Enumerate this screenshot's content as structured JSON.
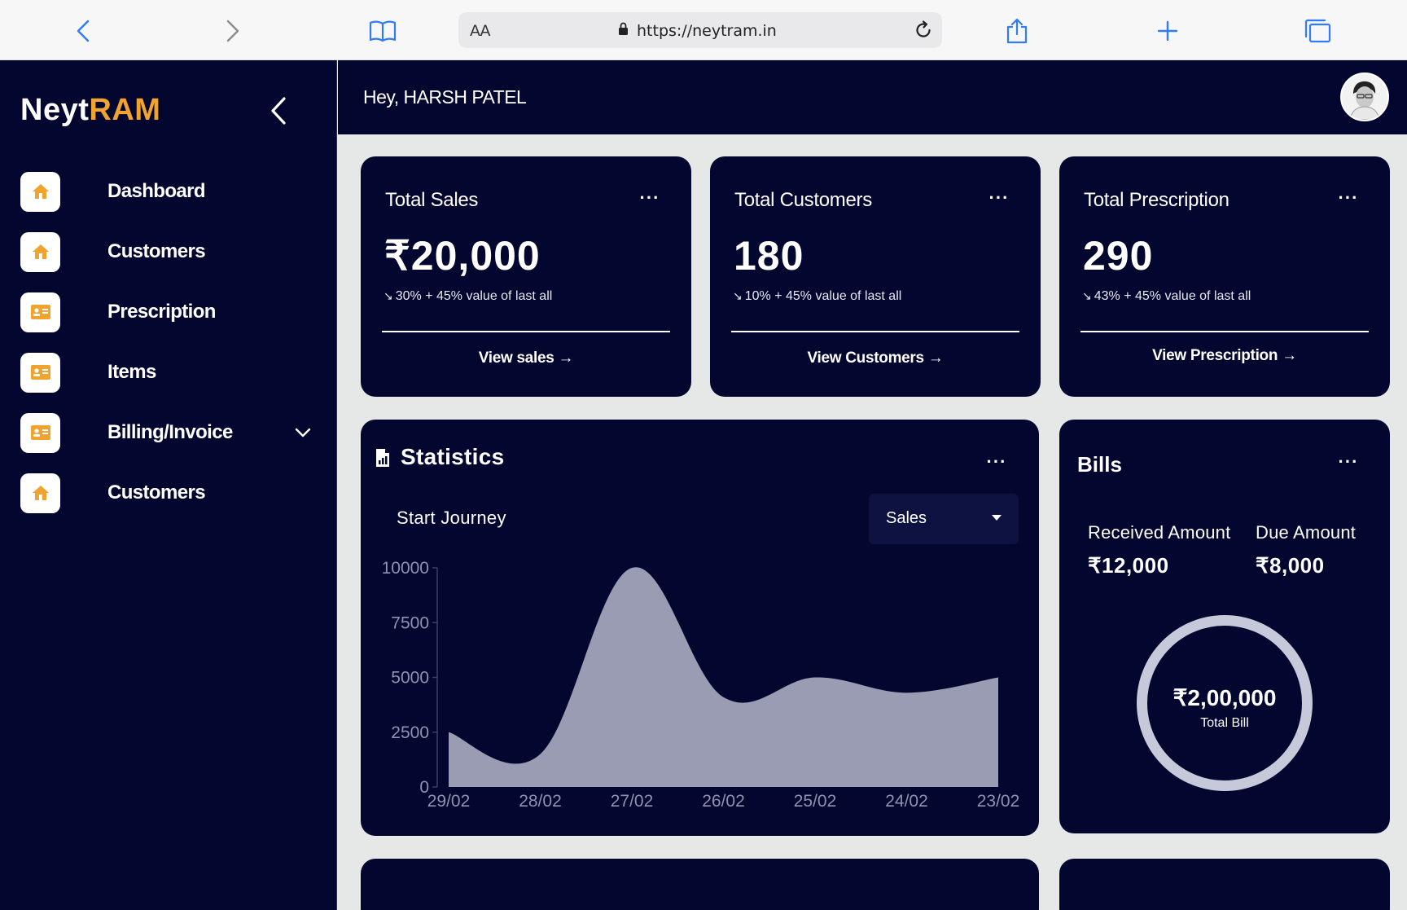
{
  "browser": {
    "text_size_label": "AA",
    "url": "https://neytram.in",
    "icons": [
      "back-icon",
      "forward-icon",
      "bookmarks-icon",
      "lock-icon",
      "reload-icon",
      "share-icon",
      "new-tab-icon",
      "tabs-icon"
    ]
  },
  "brand": {
    "part1": "Neyt",
    "part2": "RAM",
    "accent_color": "#f0a32e"
  },
  "sidebar": {
    "items": [
      {
        "label": "Dashboard",
        "icon": "home-icon"
      },
      {
        "label": "Customers",
        "icon": "home-icon"
      },
      {
        "label": "Prescription",
        "icon": "id-card-icon"
      },
      {
        "label": "Items",
        "icon": "id-card-icon"
      },
      {
        "label": "Billing/Invoice",
        "icon": "id-card-icon",
        "has_dropdown": true
      },
      {
        "label": "Customers",
        "icon": "home-icon"
      }
    ]
  },
  "header": {
    "greeting": "Hey, HARSH PATEL",
    "avatar": "user-avatar"
  },
  "stats": [
    {
      "title": "Total Sales",
      "value": "₹20,000",
      "change": "30% + 45% value of last all",
      "link": "View sales →"
    },
    {
      "title": "Total Customers",
      "value": "180",
      "change": "10% + 45% value of last all",
      "link": "View Customers →"
    },
    {
      "title": "Total Prescription",
      "value": "290",
      "change": "43% + 45% value of last all",
      "link": "View Prescription →"
    }
  ],
  "statistics": {
    "title": "Statistics",
    "subtitle": "Start Journey",
    "select_value": "Sales"
  },
  "chart_data": {
    "type": "area",
    "x": [
      "29/02",
      "28/02",
      "27/02",
      "26/02",
      "25/02",
      "24/02",
      "23/02"
    ],
    "values": [
      2500,
      1500,
      10000,
      4100,
      5000,
      4300,
      5000
    ],
    "ylim": [
      0,
      10000
    ],
    "yticks": [
      0,
      2500,
      5000,
      7500,
      10000
    ],
    "fill_color": "#9a9cb3",
    "grid": false
  },
  "bills": {
    "title": "Bills",
    "received_label": "Received Amount",
    "received_value": "₹12,000",
    "due_label": "Due Amount",
    "due_value": "₹8,000",
    "total_value": "₹2,00,000",
    "total_label": "Total Bill"
  },
  "colors": {
    "panel": "#03062e",
    "background": "#e6e8e8",
    "accent": "#f0a32e"
  }
}
